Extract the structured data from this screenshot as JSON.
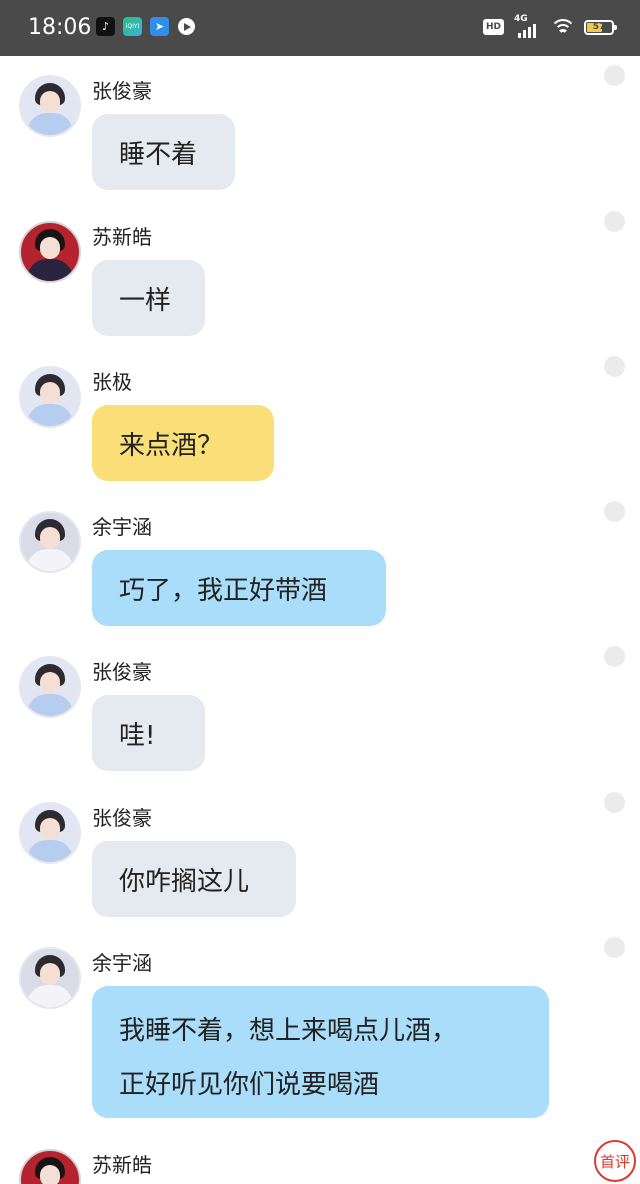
{
  "status_bar": {
    "time": "18:06",
    "network": "4G",
    "hd": "HD",
    "battery": "57",
    "battery_level": 0.57,
    "app_icons": [
      "tiktok-icon",
      "iqiyi-icon",
      "telegram-icon",
      "video-player-icon"
    ]
  },
  "messages": [
    {
      "sender": "张俊豪",
      "text": "睡不着",
      "bubble_color": "#e5e9f0",
      "avatar": "blue-outfit"
    },
    {
      "sender": "苏新皓",
      "text": "一样",
      "bubble_color": "#e5e9f0",
      "avatar": "red-background"
    },
    {
      "sender": "张极",
      "text": "来点酒？",
      "bubble_color": "#fadf78",
      "avatar": "blue-outfit"
    },
    {
      "sender": "余宇涵",
      "text": "巧了，我正好带酒",
      "bubble_color": "#a9ddf9",
      "avatar": "white-outfit"
    },
    {
      "sender": "张俊豪",
      "text": "哇!",
      "bubble_color": "#e5e9f0",
      "avatar": "blue-outfit"
    },
    {
      "sender": "张俊豪",
      "text": "你咋搁这儿",
      "bubble_color": "#e5e9f0",
      "avatar": "blue-outfit"
    },
    {
      "sender": "余宇涵",
      "text_lines": [
        "我睡不着，想上来喝点儿酒，",
        "正好听见你们说要喝酒"
      ],
      "bubble_color": "#a9ddf9",
      "avatar": "white-outfit"
    },
    {
      "sender": "苏新皓",
      "avatar": "red-background"
    }
  ],
  "comment_button": {
    "label": "首评"
  }
}
